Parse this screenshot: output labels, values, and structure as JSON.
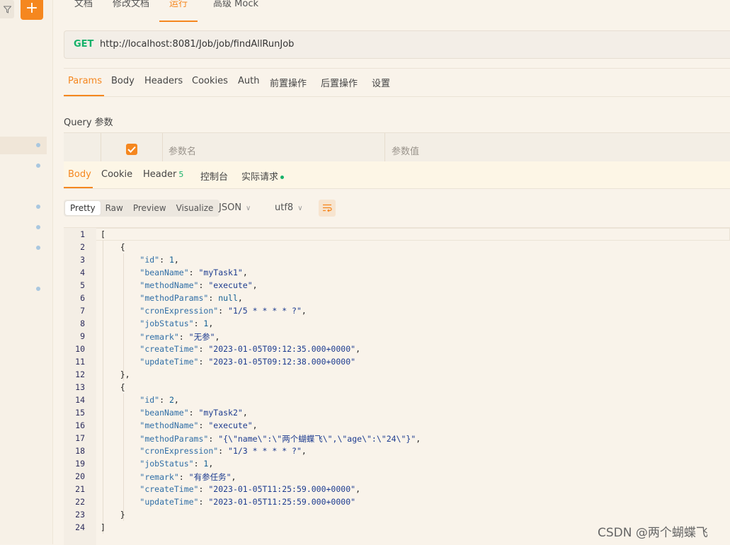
{
  "sidebar": {
    "add_label": "+",
    "filter_icon": "filter-icon"
  },
  "top_tabs": [
    {
      "label": "文档",
      "active": false
    },
    {
      "label": "修改文档",
      "active": false
    },
    {
      "label": "运行",
      "active": true
    },
    {
      "label": "高级 Mock",
      "active": false
    }
  ],
  "request": {
    "method": "GET",
    "url": "http://localhost:8081/Job/job/findAllRunJob"
  },
  "request_tabs": [
    {
      "label": "Params",
      "active": true
    },
    {
      "label": "Body",
      "active": false
    },
    {
      "label": "Headers",
      "active": false
    },
    {
      "label": "Cookies",
      "active": false
    },
    {
      "label": "Auth",
      "active": false
    },
    {
      "label": "前置操作",
      "active": false
    },
    {
      "label": "后置操作",
      "active": false
    },
    {
      "label": "设置",
      "active": false
    }
  ],
  "query": {
    "label": "Query 参数",
    "col_name": "参数名",
    "col_value": "参数值"
  },
  "response_tabs": [
    {
      "label": "Body",
      "active": true
    },
    {
      "label": "Cookie",
      "active": false
    },
    {
      "label": "Header",
      "badge": "5",
      "active": false
    },
    {
      "label": "控制台",
      "active": false
    },
    {
      "label": "实际请求",
      "active": false
    }
  ],
  "format": {
    "modes": [
      "Pretty",
      "Raw",
      "Preview",
      "Visualize"
    ],
    "active_mode": "Pretty",
    "language": "JSON",
    "encoding": "utf8"
  },
  "code_lines": [
    "[",
    "    {",
    "        \"id\": 1,",
    "        \"beanName\": \"myTask1\",",
    "        \"methodName\": \"execute\",",
    "        \"methodParams\": null,",
    "        \"cronExpression\": \"1/5 * * * * ?\",",
    "        \"jobStatus\": 1,",
    "        \"remark\": \"无参\",",
    "        \"createTime\": \"2023-01-05T09:12:35.000+0000\",",
    "        \"updateTime\": \"2023-01-05T09:12:38.000+0000\"",
    "    },",
    "    {",
    "        \"id\": 2,",
    "        \"beanName\": \"myTask2\",",
    "        \"methodName\": \"execute\",",
    "        \"methodParams\": \"{\\\"name\\\":\\\"两个蝴蝶飞\\\",\\\"age\\\":\\\"24\\\"}\",",
    "        \"cronExpression\": \"1/3 * * * * ?\",",
    "        \"jobStatus\": 1,",
    "        \"remark\": \"有参任务\",",
    "        \"createTime\": \"2023-01-05T11:25:59.000+0000\",",
    "        \"updateTime\": \"2023-01-05T11:25:59.000+0000\"",
    "    }",
    "]"
  ],
  "watermark": "CSDN @两个蝴蝶飞",
  "colors": {
    "accent": "#f5871f",
    "method_get": "#17b26a",
    "background": "#f9f3ea"
  }
}
